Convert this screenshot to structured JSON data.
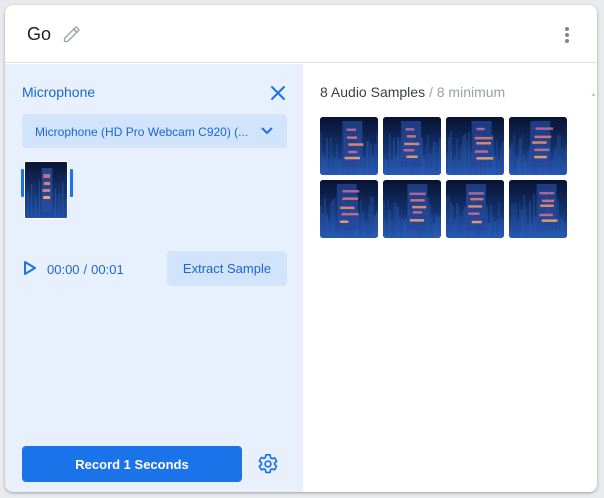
{
  "header": {
    "class_name": "Go",
    "edit_icon": "pencil-icon",
    "menu_icon": "more-vert-icon"
  },
  "recorder": {
    "title": "Microphone",
    "close_icon": "close-icon",
    "device": {
      "selected": "Microphone (HD Pro Webcam C920) (...",
      "icon": "chevron-down-icon"
    },
    "playback": {
      "play_icon": "play-icon",
      "current": "00:00",
      "separator": "/",
      "duration": "00:01"
    },
    "extract_label": "Extract Sample",
    "record_label": "Record 1 Seconds",
    "settings_icon": "gear-icon"
  },
  "samples": {
    "count_label": "8 Audio Samples",
    "min_label": "/ 8 minimum",
    "items": [
      {
        "id": 1
      },
      {
        "id": 2
      },
      {
        "id": 3
      },
      {
        "id": 4
      },
      {
        "id": 5
      },
      {
        "id": 6
      },
      {
        "id": 7
      },
      {
        "id": 8
      }
    ]
  },
  "colors": {
    "accent": "#1a73e8",
    "accent_text": "#1967d2",
    "panel_bg": "#e8f0fe",
    "button_tint": "#d2e3fc"
  }
}
